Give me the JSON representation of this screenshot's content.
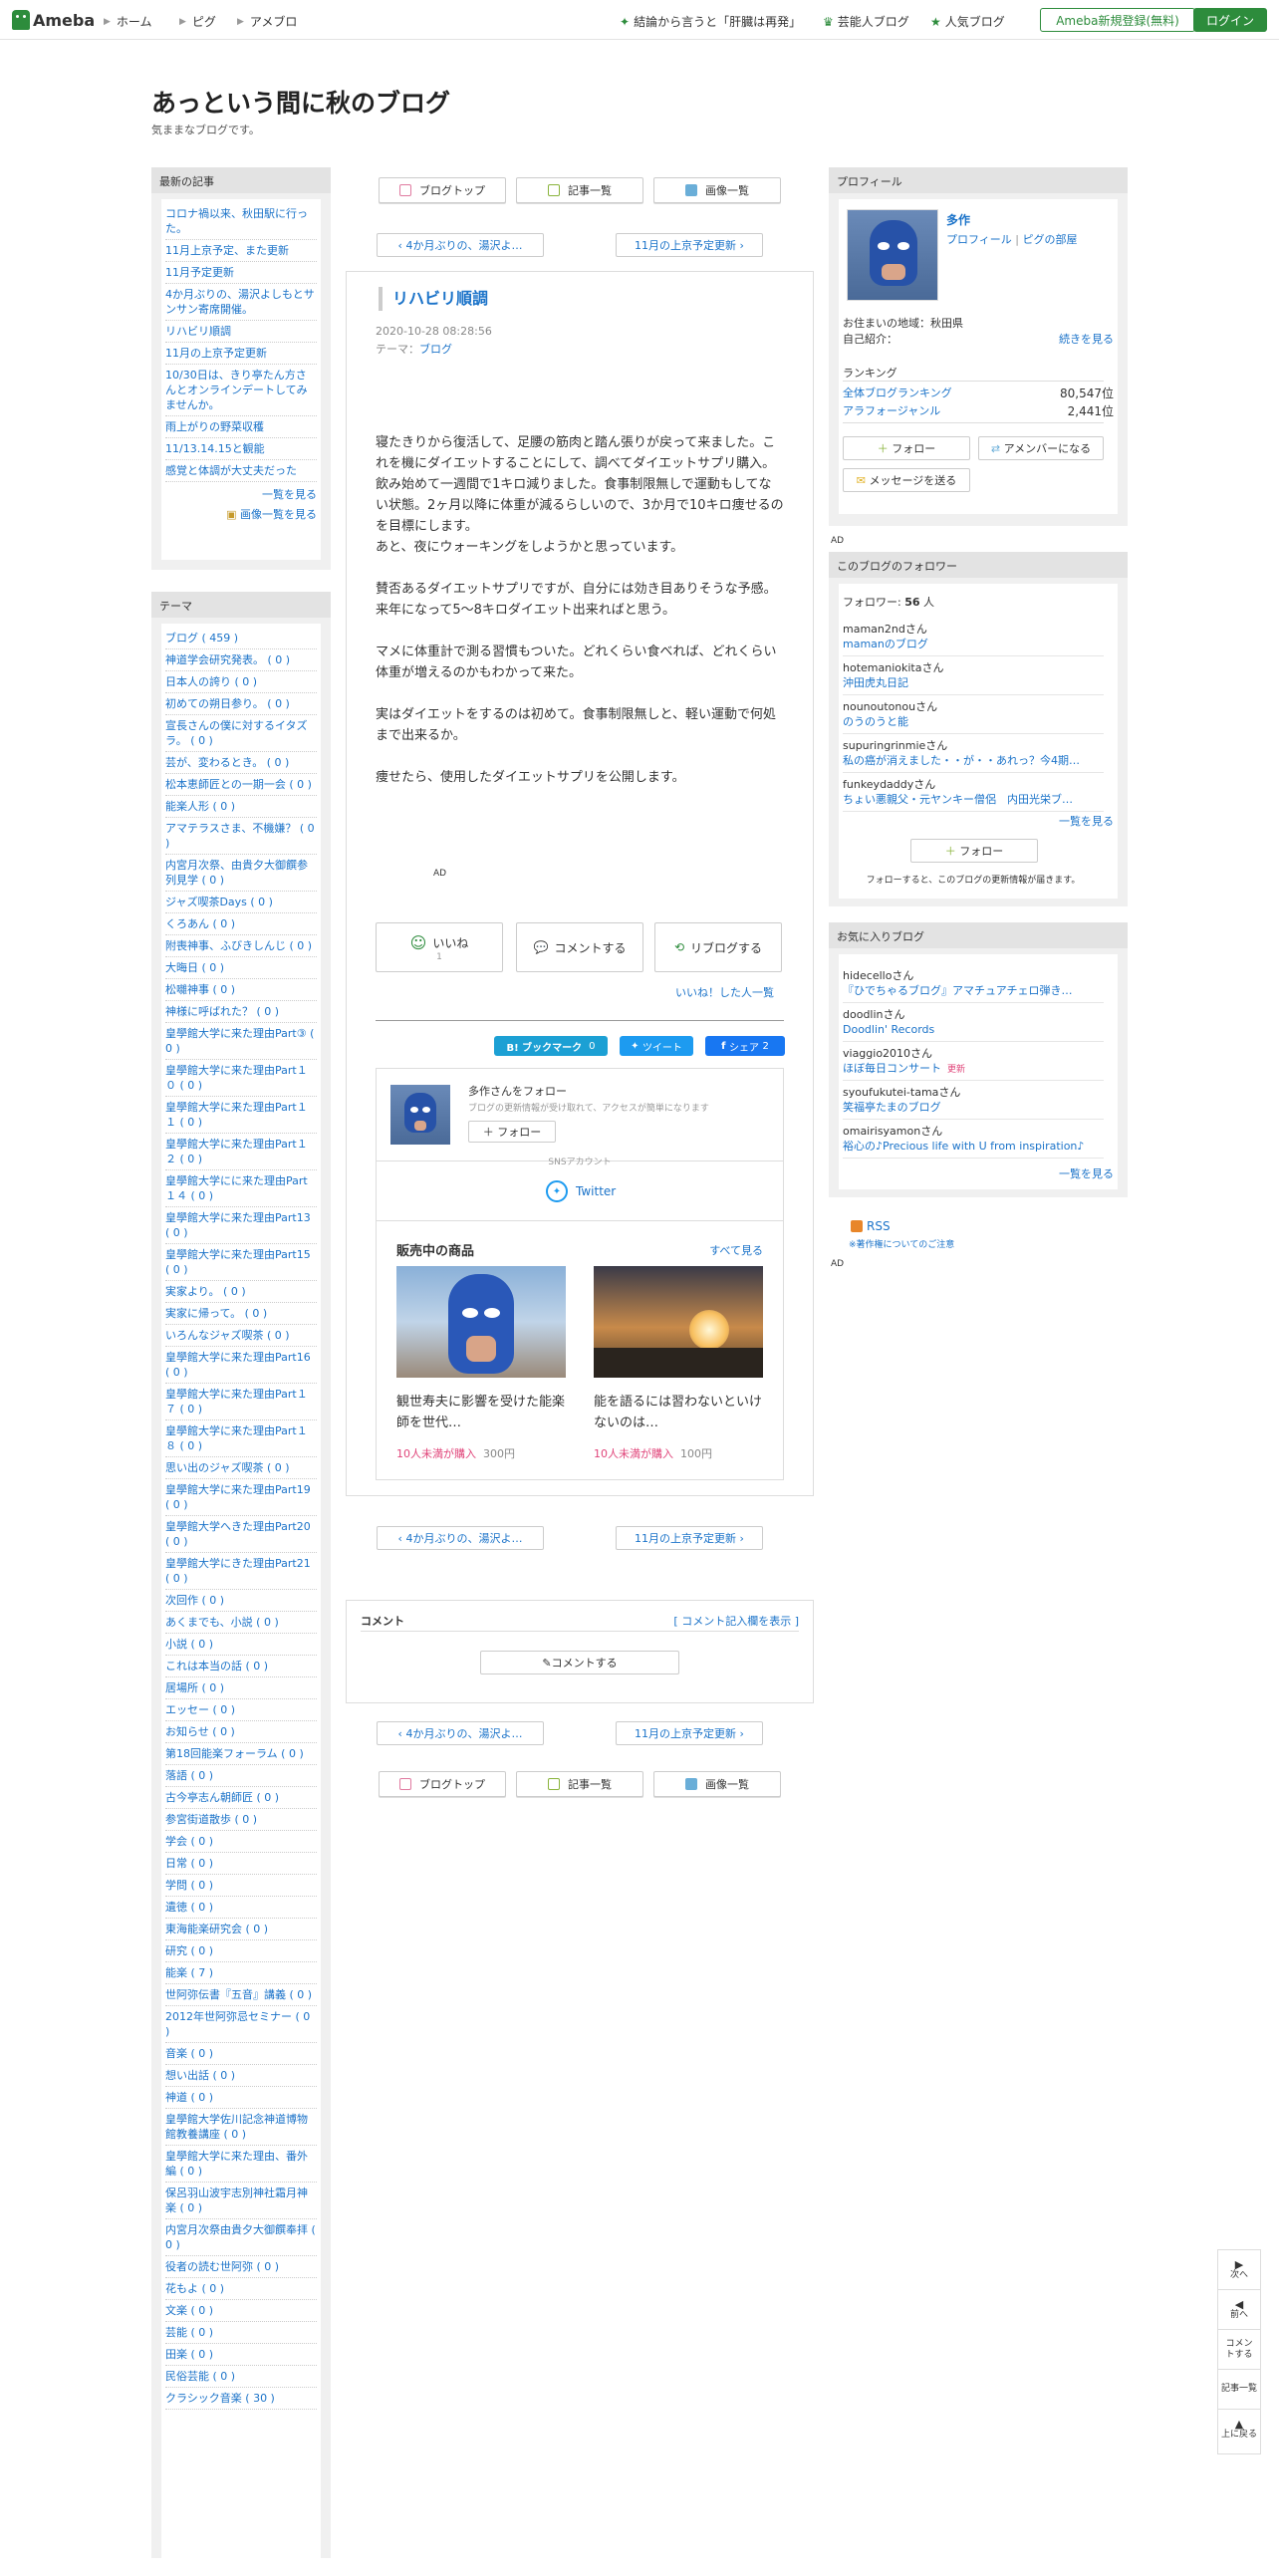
{
  "header": {
    "logo": "Ameba",
    "nav_left": [
      "ホーム",
      "ピグ",
      "アメブロ"
    ],
    "nav_right": [
      "結論から言うと「肝臓は再発」",
      "芸能人ブログ",
      "人気ブログ"
    ],
    "register": "Ameba新規登録(無料)",
    "login": "ログイン"
  },
  "blog": {
    "title": "あっという間に秋のブログ",
    "description": "気ままなブログです。"
  },
  "recent": {
    "heading": "最新の記事",
    "items": [
      "コロナ禍以来、秋田駅に行った。",
      "11月上京予定、また更新",
      "11月予定更新",
      "4か月ぶりの、湯沢よしもとサンサン寄席開催。",
      "リハビリ順調",
      "11月の上京予定更新",
      "10/30日は、きり亭たん方さんとオンラインデートしてみませんか。",
      "雨上がりの野菜収穫",
      "11/13.14.15と観能",
      "感覚と体調が大丈夫だった"
    ],
    "more": "一覧を見る",
    "images": "画像一覧を見る"
  },
  "themes": {
    "heading": "テーマ",
    "items": [
      "ブログ ( 459 )",
      "神道学会研究発表。 ( 0 )",
      "日本人の誇り ( 0 )",
      "初めての朔日参り。 ( 0 )",
      "宣長さんの僕に対するイタズラ。 ( 0 )",
      "芸が、変わるとき。 ( 0 )",
      "松本恵師匠との一期一会 ( 0 )",
      "能楽人形 ( 0 )",
      "アマテラスさま、不機嫌？ ( 0 )",
      "内宮月次祭、由貴夕大御饌参列見学 ( 0 )",
      "ジャズ喫茶Days ( 0 )",
      "くろあん ( 0 )",
      "附喪神事、ふびきしんじ ( 0 )",
      "大晦日 ( 0 )",
      "松囃神事 ( 0 )",
      "神様に呼ばれた？ ( 0 )",
      "皇學館大学に来た理由Part③ ( 0 )",
      "皇學館大学に来た理由Part１０ ( 0 )",
      "皇學館大学に来た理由Part１１ ( 0 )",
      "皇學館大学に来た理由Part１２ ( 0 )",
      "皇學館大学にに来た理由Part１４ ( 0 )",
      "皇學館大学に来た理由Part13 ( 0 )",
      "皇學館大学に来た理由Part15 ( 0 )",
      "実家より。 ( 0 )",
      "実家に帰って。 ( 0 )",
      "いろんなジャズ喫茶 ( 0 )",
      "皇學館大学に来た理由Part16 ( 0 )",
      "皇學館大学に来た理由Part１７ ( 0 )",
      "皇學館大学に来た理由Part１８ ( 0 )",
      "思い出のジャズ喫茶 ( 0 )",
      "皇學館大学に来た理由Part19 ( 0 )",
      "皇學館大学へきた理由Part20 ( 0 )",
      "皇學館大学にきた理由Part21 ( 0 )",
      "次回作 ( 0 )",
      "あくまでも、小説 ( 0 )",
      "小説 ( 0 )",
      "これは本当の話 ( 0 )",
      "居場所 ( 0 )",
      "エッセー ( 0 )",
      "お知らせ ( 0 )",
      "第18回能楽フォーラム ( 0 )",
      "落語 ( 0 )",
      "古今亭志ん朝師匠 ( 0 )",
      "参宮街道散歩 ( 0 )",
      "学会 ( 0 )",
      "日常 ( 0 )",
      "学問 ( 0 )",
      "遺徳 ( 0 )",
      "東海能楽研究会 ( 0 )",
      "研究 ( 0 )",
      "能楽 ( 7 )",
      "世阿弥伝書『五音』講義 ( 0 )",
      "2012年世阿弥忌セミナー ( 0 )",
      "音楽 ( 0 )",
      "想い出話 ( 0 )",
      "神道 ( 0 )",
      "皇學館大学佐川記念神道博物館教養講座 ( 0 )",
      "皇學館大学に来た理由、番外編 ( 0 )",
      "保呂羽山波宇志別神社霜月神楽 ( 0 )",
      "内宮月次祭由貴夕大御饌奉拝 ( 0 )",
      "役者の読む世阿弥 ( 0 )",
      "花もよ ( 0 )",
      "文楽 ( 0 )",
      "芸能 ( 0 )",
      "田楽 ( 0 )",
      "民俗芸能 ( 0 )",
      "クラシック音楽 ( 30 )"
    ]
  },
  "toolbar": {
    "top": "ブログトップ",
    "articles": "記事一覧",
    "images": "画像一覧"
  },
  "pager": {
    "prev": "4か月ぶりの、湯沢よ…",
    "next": "11月の上京予定更新"
  },
  "article": {
    "title": "リハビリ順調",
    "date": "2020-10-28 08:28:56",
    "theme_label": "テーマ：",
    "theme": "ブログ",
    "paragraphs": [
      "寝たきりから復活して、足腰の筋肉と踏ん張りが戻って来ました。これを機にダイエットすることにして、調べてダイエットサプリ購入。飲み始めて一週間で1キロ減りました。食事制限無しで運動もしてない状態。2ヶ月以降に体重が減るらしいので、3か月で10キロ痩せるのを目標にします。\nあと、夜にウォーキングをしようかと思っています。",
      "賛否あるダイエットサプリですが、自分には効き目ありそうな予感。来年になって5〜8キロダイエット出来ればと思う。",
      "マメに体重計で測る習慣もついた。どれくらい食べれば、どれくらい体重が増えるのかもわかって来た。",
      "実はダイエットをするのは初めて。食事制限無しと、軽い運動で何処まで出来るか。",
      "痩せたら、使用したダイエットサプリを公開します。"
    ],
    "ad": "AD"
  },
  "reactions": {
    "like": "いいね",
    "like_count": "1",
    "comment": "コメントする",
    "reblog": "リブログする",
    "like_list": "いいね！した人一覧"
  },
  "share": {
    "hatena": "B! ブックマーク",
    "hatena_count": "0",
    "twitter": "ツイート",
    "facebook": "シェア",
    "facebook_count": "2"
  },
  "follow_card": {
    "title": "多作さんをフォロー",
    "sub": "ブログの更新情報が受け取れて、アクセスが簡単になります",
    "follow": "フォロー",
    "sns_label": "SNSアカウント",
    "twitter": "Twitter",
    "shop_title": "販売中の商品",
    "shop_more": "すべて見る",
    "products": [
      {
        "name": "観世寿夫に影響を受けた能楽師を世代…",
        "buyers": "10人未満が購入",
        "price": "300円"
      },
      {
        "name": "能を語るには習わないといけないのは…",
        "buyers": "10人未満が購入",
        "price": "100円"
      }
    ]
  },
  "comments": {
    "heading": "コメント",
    "show_form": "[ コメント記入欄を表示 ]",
    "button": "コメントする"
  },
  "profile": {
    "heading": "プロフィール",
    "name": "多作",
    "links": [
      "プロフィール",
      "ピグの部屋"
    ],
    "location": "お住まいの地域：秋田県",
    "intro": "自己紹介：",
    "more": "続きを見る",
    "ranking_label": "ランキング",
    "ranks": [
      {
        "label": "全体ブログランキング",
        "value": "80,547位"
      },
      {
        "label": "アラフォージャンル",
        "value": "2,441位"
      }
    ],
    "follow": "フォロー",
    "member": "アメンバーになる",
    "message": "メッセージを送る"
  },
  "followers": {
    "heading": "このブログのフォロワー",
    "count_label": "フォロワー:",
    "count": "56",
    "unit": "人",
    "items": [
      {
        "user": "maman2ndさん",
        "blog": "mamanのブログ"
      },
      {
        "user": "hotemaniokitaさん",
        "blog": "沖田虎丸日記"
      },
      {
        "user": "nounoutonouさん",
        "blog": "のうのうと能"
      },
      {
        "user": "supuringrinmieさん",
        "blog": "私の癌が消えました・・が・・あれっ？今4期…"
      },
      {
        "user": "funkeydaddyさん",
        "blog": "ちょい悪親父・元ヤンキー僧侶　内田光栄ブ…"
      }
    ],
    "more": "一覧を見る",
    "follow": "フォロー",
    "note": "フォローすると、このブログの更新情報が届きます。"
  },
  "favorites": {
    "heading": "お気に入りブログ",
    "items": [
      {
        "user": "hidecelloさん",
        "blog": "『ひでちゃるブログ』アマチュアチェロ弾き…",
        "badge": ""
      },
      {
        "user": "doodlinさん",
        "blog": "Doodlin' Records",
        "badge": ""
      },
      {
        "user": "viaggio2010さん",
        "blog": "ほぼ毎日コンサート",
        "badge": "更新"
      },
      {
        "user": "syoufukutei-tamaさん",
        "blog": "笑福亭たまのブログ",
        "badge": ""
      },
      {
        "user": "omairisyamonさん",
        "blog": "裕心の♪Precious life with U from inspiration♪",
        "badge": ""
      }
    ],
    "more": "一覧を見る"
  },
  "rss": {
    "label": "RSS",
    "copyright": "※著作権についてのご注意"
  },
  "ad_labels": [
    "AD",
    "AD"
  ],
  "sidenav": [
    "次へ",
    "前へ",
    "コメントする",
    "記事一覧",
    "上に戻る"
  ]
}
